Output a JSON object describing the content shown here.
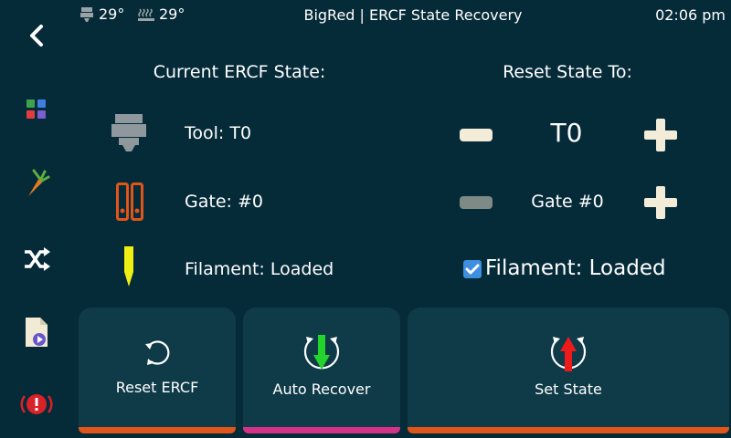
{
  "header": {
    "extruder_temp": "29°",
    "bed_temp": "29°",
    "title": "BigRed | ERCF State Recovery",
    "time": "02:06 pm"
  },
  "sidebar": [
    {
      "icon": "back-icon"
    },
    {
      "icon": "main-menu-icon"
    },
    {
      "icon": "carrot-icon"
    },
    {
      "icon": "shuffle-icon"
    },
    {
      "icon": "file-play-icon"
    },
    {
      "icon": "emergency-stop-icon"
    }
  ],
  "current": {
    "heading": "Current ERCF State:",
    "tool": "Tool: T0",
    "gate": "Gate: #0",
    "filament": "Filament: Loaded"
  },
  "reset": {
    "heading": "Reset State To:",
    "tool": "T0",
    "gate": "Gate #0",
    "filament": "Filament: Loaded",
    "filament_checked": true
  },
  "actions": {
    "reset_ercf": "Reset ERCF",
    "auto_recover": "Auto Recover",
    "set_state": "Set State"
  },
  "colors": {
    "background": "#052a38",
    "card": "#0f3a48",
    "accent_orange": "#e0551a",
    "accent_magenta": "#d6328a",
    "checkbox": "#3e8fe0"
  }
}
